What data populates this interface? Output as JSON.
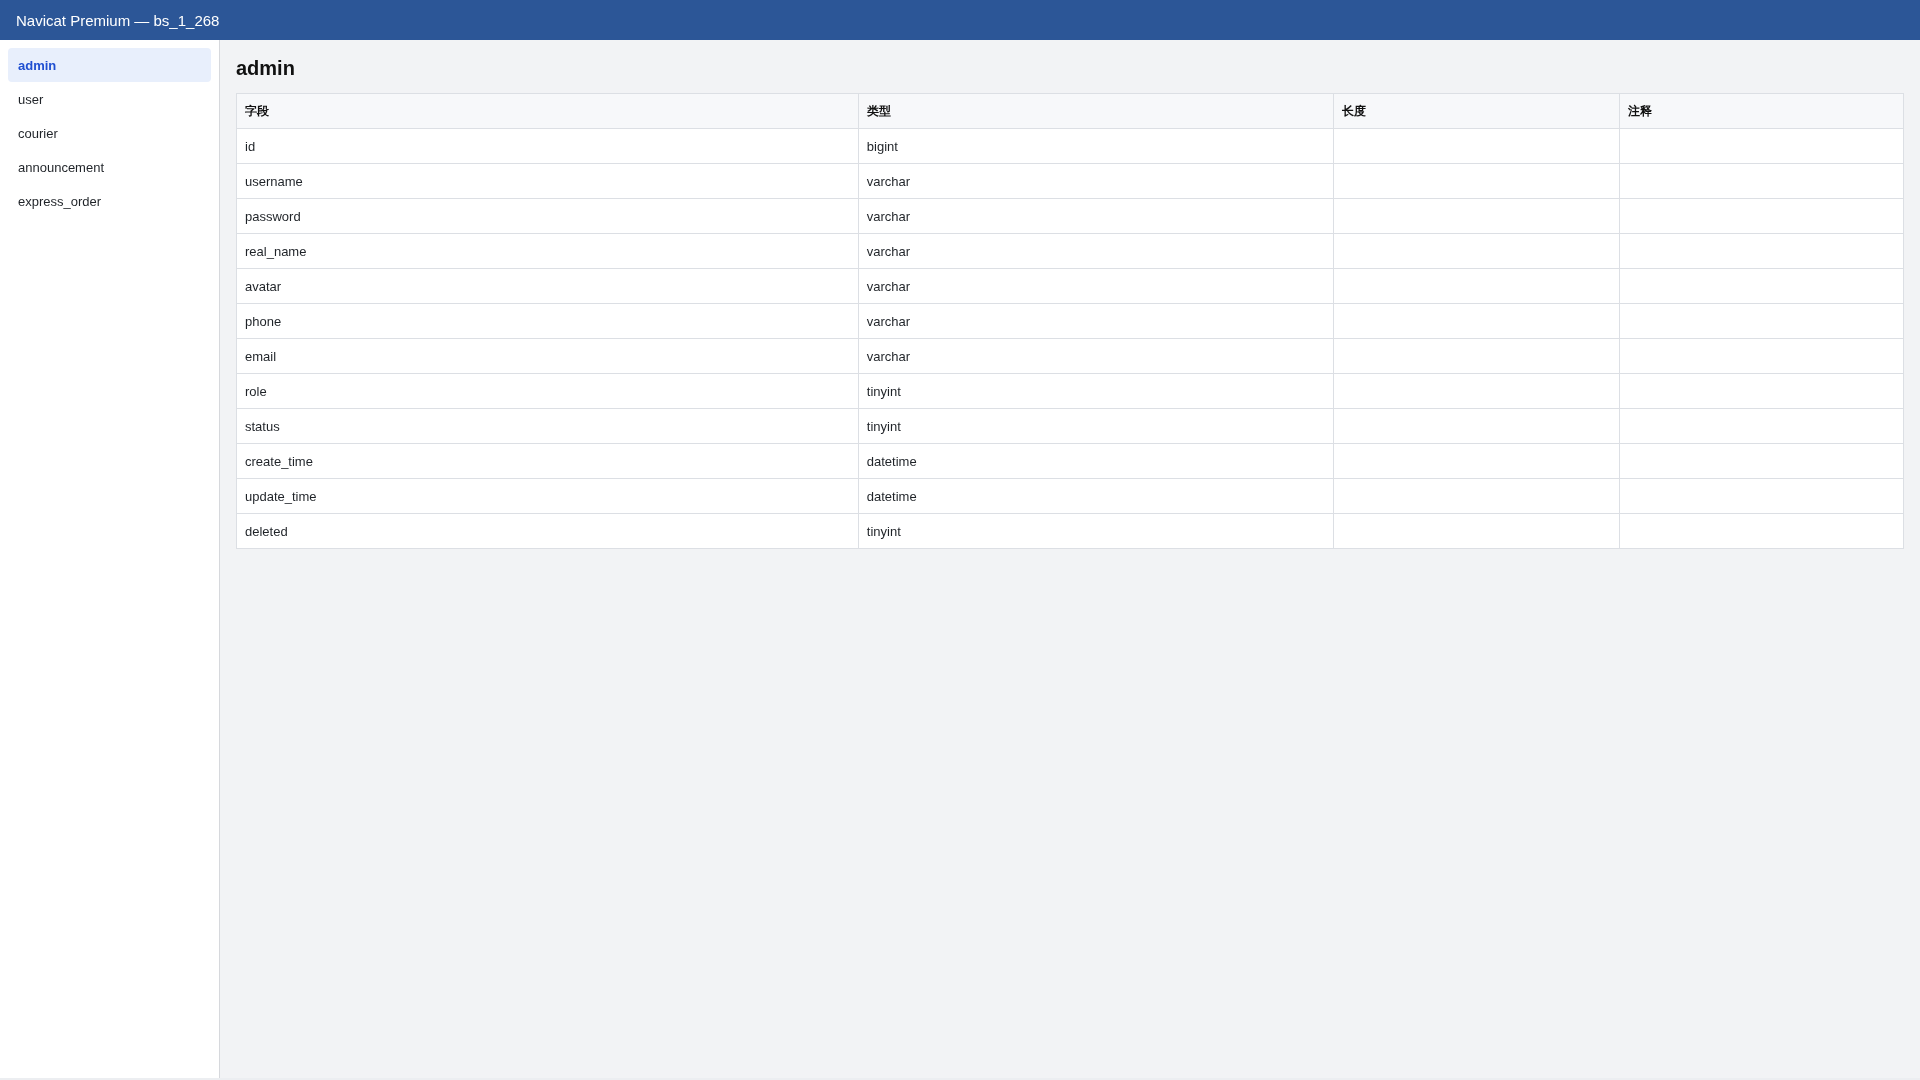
{
  "window": {
    "title": "Navicat Premium — bs_1_268"
  },
  "sidebar": {
    "items": [
      {
        "label": "admin",
        "selected": true
      },
      {
        "label": "user",
        "selected": false
      },
      {
        "label": "courier",
        "selected": false
      },
      {
        "label": "announcement",
        "selected": false
      },
      {
        "label": "express_order",
        "selected": false
      }
    ]
  },
  "content": {
    "heading": "admin"
  },
  "table": {
    "columns": [
      "字段",
      "类型",
      "长度",
      "注释"
    ],
    "rows": [
      {
        "cells": [
          "id",
          "bigint"
        ]
      },
      {
        "cells": [
          "username",
          "varchar"
        ]
      },
      {
        "cells": [
          "password",
          "varchar"
        ]
      },
      {
        "cells": [
          "real_name",
          "varchar"
        ]
      },
      {
        "cells": [
          "avatar",
          "varchar"
        ]
      },
      {
        "cells": [
          "phone",
          "varchar"
        ]
      },
      {
        "cells": [
          "email",
          "varchar"
        ]
      },
      {
        "cells": [
          "role",
          "tinyint"
        ]
      },
      {
        "cells": [
          "status",
          "tinyint"
        ]
      },
      {
        "cells": [
          "create_time",
          "datetime"
        ]
      },
      {
        "cells": [
          "update_time",
          "datetime"
        ]
      },
      {
        "cells": [
          "deleted",
          "tinyint"
        ]
      }
    ]
  }
}
